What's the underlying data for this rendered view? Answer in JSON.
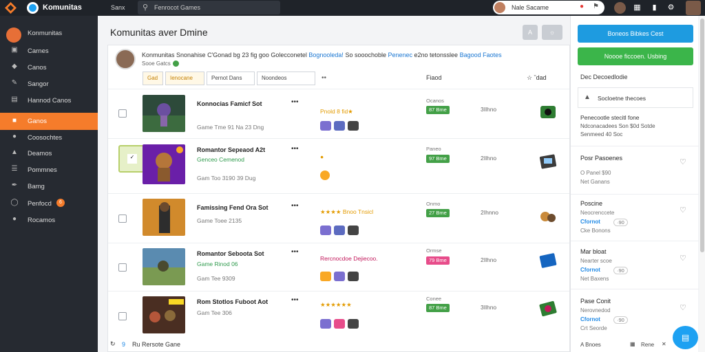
{
  "topbar": {
    "app_name": "Komunitas",
    "menu_label": "Sanx",
    "search_placeholder": "Fenrocot Games",
    "user_name": "Nale Sacame",
    "icons": [
      "diamond-logo-icon",
      "globe-logo-icon",
      "search-icon",
      "alert-icon",
      "flag-icon",
      "avatar",
      "grid-icon",
      "notification-icon",
      "settings-icon",
      "avatar"
    ]
  },
  "sidebar": {
    "items": [
      {
        "label": "Konmunitas",
        "icon": "home-avatar"
      },
      {
        "label": "Carnes",
        "icon": "square-icon"
      },
      {
        "label": "Canos",
        "icon": "diamond-icon"
      },
      {
        "label": "Sangor",
        "icon": "pen-icon"
      },
      {
        "label": "Hannod Canos",
        "icon": "card-icon"
      },
      {
        "label": "Ganos",
        "icon": "game-icon",
        "active": true
      },
      {
        "label": "Coosochtes",
        "icon": "people-icon"
      },
      {
        "label": "Deamos",
        "icon": "folder-icon"
      },
      {
        "label": "Pommnes",
        "icon": "list-icon"
      },
      {
        "label": "Bamg",
        "icon": "tool-icon"
      },
      {
        "label": "Penfocd",
        "icon": "circle-icon",
        "badge": "6"
      },
      {
        "label": "Rocamos",
        "icon": "dot-icon"
      }
    ]
  },
  "main": {
    "title": "Komunitas aver Dmine",
    "header_btn_1": "A",
    "header_btn_2": "☼",
    "info_text_1": "Konmunitas Snonahise C'Gonad bg 23 fig goo Golecconetel ",
    "info_link_1": "Bognooleda!",
    "info_text_2": " So sooochoble ",
    "info_link_2": "Penenec",
    "info_text_3": " e2no tetonsslee ",
    "info_link_3": "Bagood Faotes",
    "info_sub": "Sooe Gatcs",
    "filters": [
      "Gad",
      "Ienocane",
      "Pernot Dans",
      "Noondeos"
    ],
    "col_header_1": "Fiaod",
    "col_header_2": "☆ ˇdad",
    "rows": [
      {
        "name": "Konnocias Famicf Sot",
        "sub": "",
        "meta": "Game  Tme  91 Na  23 Dng",
        "rating": "Pnold 8 fid★",
        "status_label": "Ocanos",
        "status": "87 Bme",
        "status_value": "3Ilhno"
      },
      {
        "name": "Romantor Sepeaod A2t",
        "sub": "Genceo Cemenod",
        "meta": "Gam  Too  3190  39 Dug",
        "rating": "",
        "status_label": "Paneo",
        "status": "97 Bme",
        "status_value": "2Ilhno"
      },
      {
        "name": "Famissing Fend Ora Sot",
        "sub": "",
        "meta": "Game  Toee  2135",
        "rating": "★★★★ Bnoo Tnsicl",
        "status_label": "Onmo",
        "status": "27 Bme",
        "status_value": "2Ihnno"
      },
      {
        "name": "Romantor Seboota Sot",
        "sub": "Game  Rinod 06",
        "meta": "Gam  Tee  9309",
        "rating": "Rercnocdoe Dejiecoo.",
        "status_label": "Ormse",
        "status": "79 Bme",
        "status_value": "2Ilhno"
      },
      {
        "name": "Rom Stotlos Fuboot Aot",
        "sub": "",
        "meta": "Gam  Tee  306",
        "rating": "★★★★★★",
        "status_label": "Conee",
        "status": "87 Bme",
        "status_value": "3Ilhno"
      }
    ],
    "footer_count": "9",
    "footer_text": "Ru   Rersote Gane"
  },
  "right_panel": {
    "btn_primary": "Boneos Bibkes Cest",
    "btn_secondary": "Noooe ficcoen.  Usbing",
    "section_1": "Dec Decoedlodie",
    "box_label": "Socloetne thecoes",
    "section_2_title": "Penecootle stecitl fone",
    "section_2_body_1": "Ndconacadees Son $0d Sotde",
    "section_2_body_2": "Senmeed 40 Soc",
    "cards": [
      {
        "title": "Posr Pasoenes",
        "line1": "O Panel  $90",
        "green": "",
        "pill": "",
        "line2": "Net Ganans"
      },
      {
        "title": "Poscine",
        "line1": "Neocrenccete",
        "green": "Cfornot",
        "pill": "·90",
        "line2": "Cke Bonons"
      },
      {
        "title": "Mar bloat",
        "line1": "Nearter scoe",
        "green": "Cfornot",
        "pill": "·90",
        "line2": "Net Baxens"
      },
      {
        "title": "Pase Conit",
        "line1": "Nerovnedod",
        "green": "Cfornot",
        "pill": "·90",
        "line2": "Crt Seorde"
      }
    ],
    "foot_left": "A  Bnoes",
    "foot_right": "Rene"
  }
}
